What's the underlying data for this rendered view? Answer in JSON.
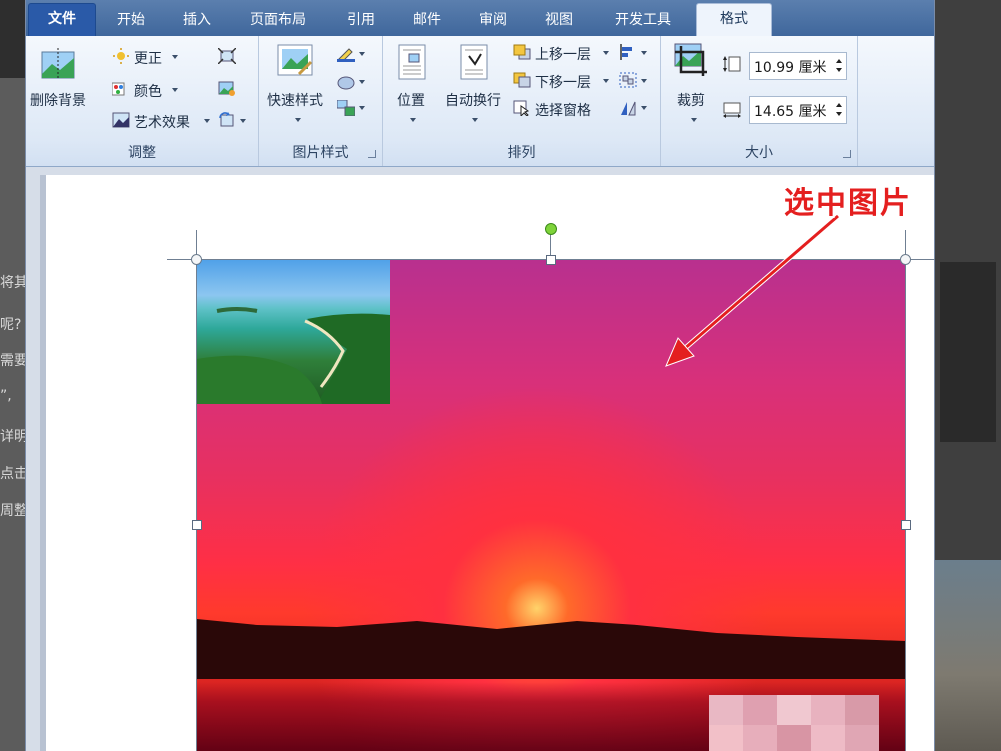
{
  "tabs": [
    {
      "label": "文件"
    },
    {
      "label": "开始"
    },
    {
      "label": "插入"
    },
    {
      "label": "页面布局"
    },
    {
      "label": "引用"
    },
    {
      "label": "邮件"
    },
    {
      "label": "审阅"
    },
    {
      "label": "视图"
    },
    {
      "label": "开发工具"
    },
    {
      "label": "格式"
    }
  ],
  "ribbon": {
    "adjust": {
      "label": "调整",
      "remove_bg": "删除背景",
      "corrections": "更正",
      "color": "颜色",
      "artistic": "艺术效果"
    },
    "picture_styles": {
      "label": "图片样式",
      "quick_styles": "快速样式"
    },
    "arrange": {
      "label": "排列",
      "position": "位置",
      "wrap_text": "自动换行",
      "bring_forward": "上移一层",
      "send_backward": "下移一层",
      "selection_pane": "选择窗格"
    },
    "size": {
      "label": "大小",
      "crop": "裁剪",
      "height": "10.99 厘米",
      "width": "14.65 厘米"
    }
  },
  "document": {
    "annotation": "选中图片"
  },
  "background": {
    "left_text": [
      "将其",
      "呢?",
      "需要",
      "”,",
      "详明",
      "点击",
      "周整"
    ]
  },
  "colors": {
    "tab_bar": "#4a72a8",
    "active_tab": "#eef4fc",
    "ribbon": "#dde8f6",
    "callout": "#e41f1f"
  }
}
